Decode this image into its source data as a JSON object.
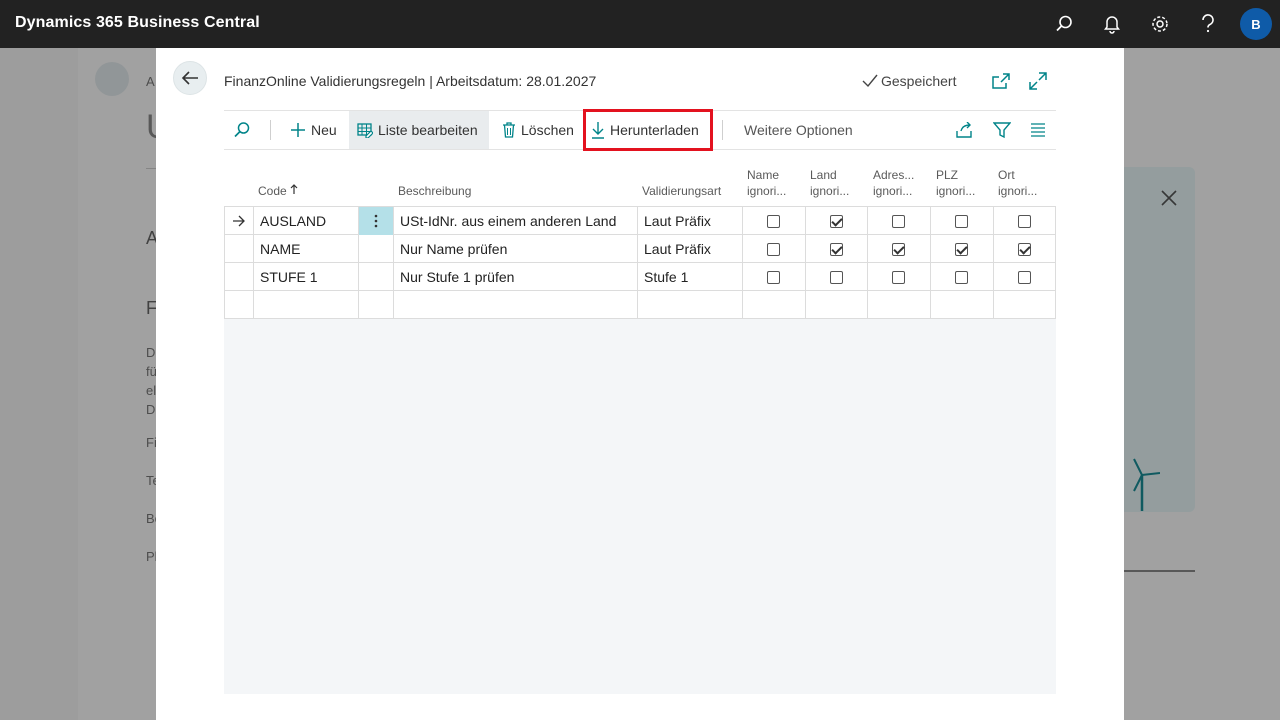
{
  "app": {
    "title": "Dynamics 365 Business Central",
    "avatar_initial": "B"
  },
  "dialog": {
    "title": "FinanzOnline Validierungsregeln | Arbeitsdatum: 28.01.2027",
    "saved_label": "Gespeichert"
  },
  "actions": {
    "new": "Neu",
    "edit_list": "Liste bearbeiten",
    "delete": "Löschen",
    "download": "Herunterladen",
    "more": "Weitere Optionen"
  },
  "columns": {
    "code": "Code",
    "description": "Beschreibung",
    "validation_type": "Validierungsart",
    "name_ignore": [
      "Name",
      "ignori..."
    ],
    "land_ignore": [
      "Land",
      "ignori..."
    ],
    "address_ignore": [
      "Adres...",
      "ignori..."
    ],
    "plz_ignore": [
      "PLZ",
      "ignori..."
    ],
    "ort_ignore": [
      "Ort",
      "ignori..."
    ]
  },
  "rows": [
    {
      "code": "AUSLAND",
      "description": "USt-IdNr. aus einem anderen Land",
      "type": "Laut Präfix",
      "checks": [
        false,
        true,
        false,
        false,
        false
      ]
    },
    {
      "code": "NAME",
      "description": "Nur Name prüfen",
      "type": "Laut Präfix",
      "checks": [
        false,
        true,
        true,
        true,
        true
      ]
    },
    {
      "code": "STUFE 1",
      "description": "Nur Stufe 1 prüfen",
      "type": "Stufe 1",
      "checks": [
        false,
        false,
        false,
        false,
        false
      ]
    }
  ],
  "background_fragments": [
    "A",
    "U",
    "A",
    "F",
    "D",
    "fü",
    "el",
    "D",
    "Fi",
    "Te",
    "Be",
    "Pl"
  ],
  "icons": {
    "appbar": [
      "search-icon",
      "bell-icon",
      "gear-icon",
      "help-icon"
    ],
    "actionbar": [
      "search-icon",
      "plus-icon",
      "edit-list-icon",
      "delete-icon",
      "download-icon",
      "share-icon",
      "filter-icon",
      "list-icon"
    ]
  },
  "colors": {
    "appbar": "#222222",
    "accent": "#008489",
    "highlight": "#e3121f",
    "avatar": "#0f5ba8"
  }
}
